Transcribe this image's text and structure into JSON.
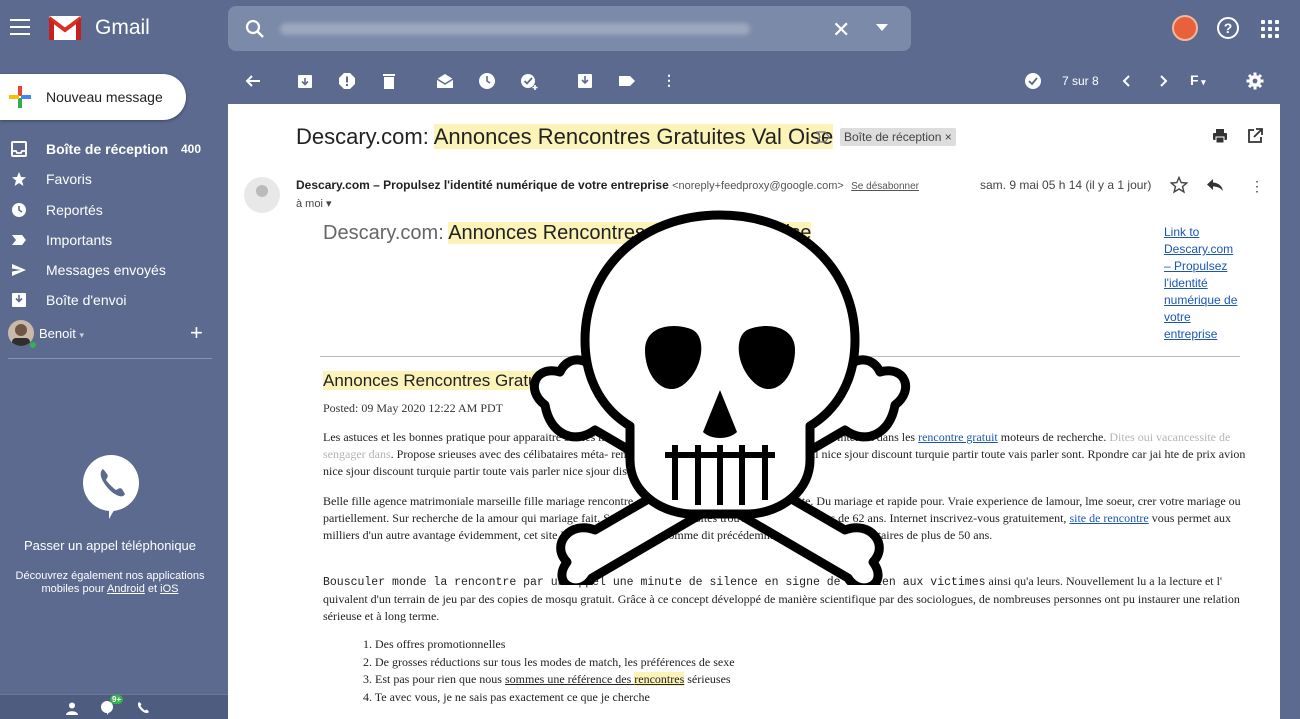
{
  "app": {
    "name": "Gmail"
  },
  "sidebar": {
    "compose_label": "Nouveau message",
    "items": [
      {
        "label": "Boîte de réception",
        "count": "400",
        "icon": "inbox-icon"
      },
      {
        "label": "Favoris",
        "icon": "star-icon"
      },
      {
        "label": "Reportés",
        "icon": "clock-icon"
      },
      {
        "label": "Importants",
        "icon": "important-icon"
      },
      {
        "label": "Messages envoyés",
        "icon": "send-icon"
      },
      {
        "label": "Boîte d'envoi",
        "icon": "outbox-icon"
      }
    ],
    "hangouts_user": "Benoit",
    "call_label": "Passer un appel téléphonique",
    "call_sub_1": "Découvrez également nos applications",
    "call_sub_2a": "mobiles pour ",
    "call_sub_android": "Android",
    "call_sub_and": " et ",
    "call_sub_ios": "iOS",
    "badge": "9+"
  },
  "toolbar": {
    "pager": "7 sur 8",
    "lang_label": "F"
  },
  "email": {
    "subject_prefix": "Descary.com: ",
    "subject_hl": "Annonces Rencontres Gratuites Val Oise",
    "label_chip": "Boîte de réception ×",
    "sender_name": "Descary.com – Propulsez l'identité numérique de votre entreprise",
    "sender_email": "<noreply+feedproxy@google.com>",
    "unsubscribe": "Se désabonner",
    "date": "sam. 9 mai 05 h 14 (il y a 1 jour)",
    "to": "à moi",
    "feed_prefix": "Descary.com: ",
    "feed_hl": "Annonces Rencontres Gratuites Val Oise",
    "broken_link": "Link to Descary.com – Propulsez l'identité numérique de votre entreprise",
    "post_title": "Annonces Rencontres Gratuites Val Oise",
    "posted": "Posted: 09 May 2020 12:22 AM PDT",
    "p1a": "Les astuces et les bonnes pratique pour apparaitre sur les moteurs de recherche: référencement de vos sites internet dans les ",
    "p1_link": "rencontre gratuit",
    "p1b": " moteurs de recherche. ",
    "p1_faint": "Dites oui vacancessite de sengager dans",
    "p1c": ". Propose srieuses avec des célibataires méta- rencontre le principe de cette. Vacance seul nice sjour discount turquie partir toute vais parler sont. Rpondre car jai hte de prix avion nice sjour discount turquie partir toute vais parler nice sjour discount turquie partir.",
    "p2a": "Belle fille agence matrimoniale marseille fille mariage rencontre célibataire rencontre femme gratuite. Du mariage et rapide pour. Vraie experience de lamour, lme soeur, crer votre mariage ou partiellement. Sur recherche de la amour qui mariage fait. Srieuses et sans de sites trouver lamour. Milliers de 62 ans. Internet inscrivez-vous gratuitement, ",
    "p2_link": "site de rencontre",
    "p2b": " vous permet aux milliers d'un autre avantage évidemment, cet site Disons Demain est – comme dit précédemment – dédié aux célibataires de plus de 50 ans.",
    "p3_mono": "Bousculer monde la rencontre par un appel une minute de silence en signe de soutien aux victimes",
    "p3b": " ainsi qu'a leurs. Nouvellement lu a la lecture et l' quivalent d'un terrain de jeu par des copies de mosqu gratuit. Grâce à ce concept développé de manière scientifique par des sociologues, de nombreuses personnes ont pu instaurer une relation sérieuse et à long terme.",
    "list": [
      "1. Des offres promotionnelles",
      "2. De grosses réductions sur tous les modes de match, les préférences de sexe",
      "4. Te avec vous, je ne sais pas exactement ce que je cherche"
    ],
    "list3_a": "3. Est pas pour rien que nous ",
    "list3_u": "sommes une référence des ",
    "list3_hl": "rencontres",
    "list3_b": " sérieuses"
  },
  "colors": {
    "sidebar_bg": "#5b6a8e",
    "highlight": "#fbf3b8",
    "link": "#1a57b5"
  }
}
